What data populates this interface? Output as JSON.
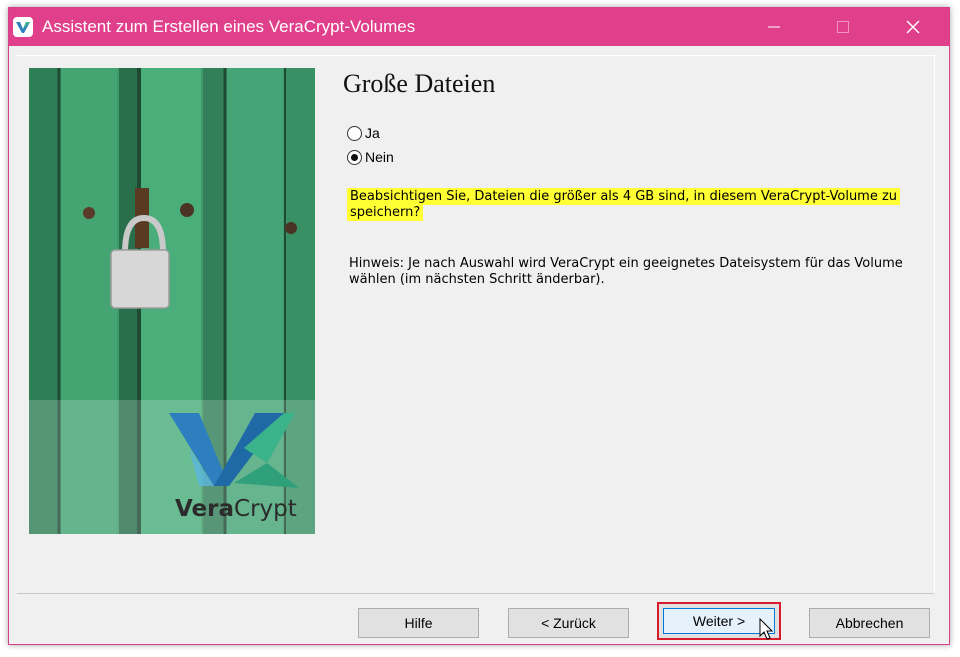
{
  "window": {
    "title": "Assistent zum Erstellen eines VeraCrypt-Volumes",
    "title_color": "#e0408b"
  },
  "page": {
    "heading": "Große Dateien",
    "options": [
      {
        "label": "Ja",
        "checked": false
      },
      {
        "label": "Nein",
        "checked": true
      }
    ],
    "question": "Beabsichtigen Sie, Dateien die größer als 4 GB sind, in diesem VeraCrypt-Volume zu speichern?",
    "highlight_color": "#ffff33",
    "hint": "Hinweis: Je nach Auswahl wird VeraCrypt ein geeignetes Dateisystem für das Volume wählen (im nächsten Schritt änderbar)."
  },
  "banner": {
    "logo_text_bold": "Vera",
    "logo_text_light": "Crypt"
  },
  "buttons": {
    "help": "Hilfe",
    "back": "< Zurück",
    "next": "Weiter >",
    "cancel": "Abbrechen",
    "next_highlight_color": "#d81b2a"
  },
  "icons": [
    "veracrypt-app-icon",
    "minimize-icon",
    "maximize-icon",
    "close-icon",
    "mouse-cursor-icon"
  ]
}
